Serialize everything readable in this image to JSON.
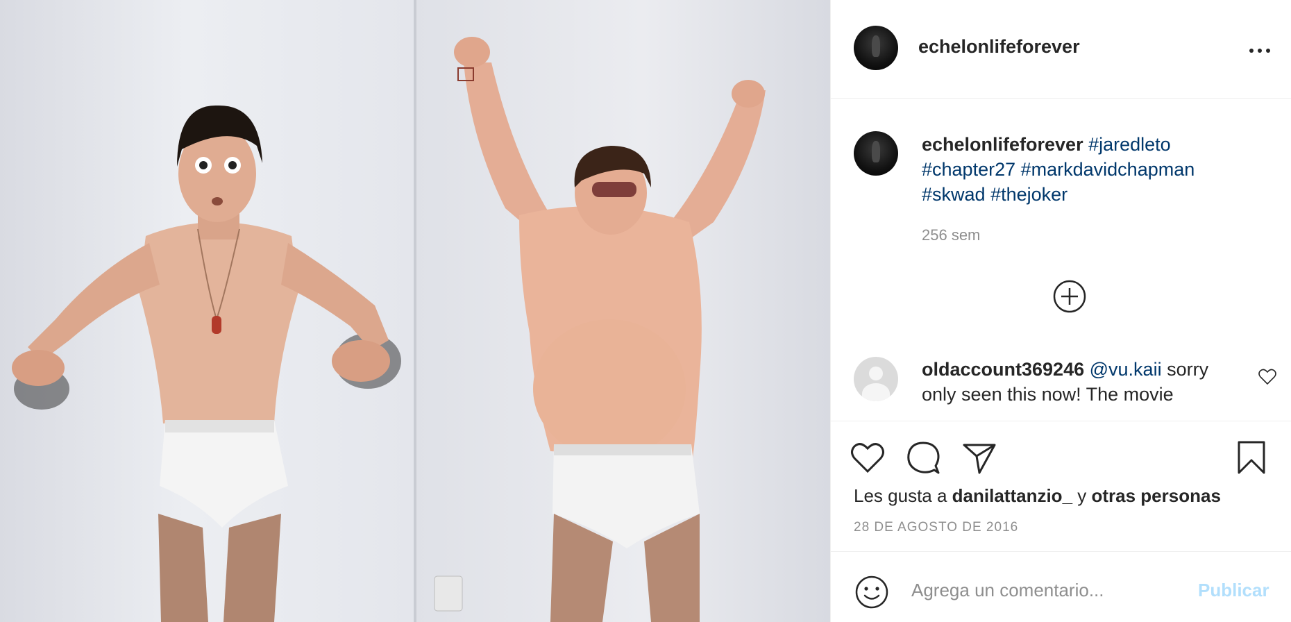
{
  "post": {
    "author": "echelonlifeforever",
    "more_icon": "more-horizontal-icon"
  },
  "caption": {
    "author": "echelonlifeforever",
    "hashtags": [
      "#jaredleto",
      "#chapter27",
      "#markdavidchapman",
      "#skwad",
      "#thejoker"
    ],
    "time_ago": "256 sem",
    "load_more_icon": "plus-circle-icon"
  },
  "comment": {
    "author": "oldaccount369246",
    "mention": "@vu.kaii",
    "text": "sorry only seen this now! The movie",
    "like_icon": "heart-icon"
  },
  "actions": {
    "like_icon": "heart-icon",
    "comment_icon": "comment-icon",
    "share_icon": "paper-plane-icon",
    "save_icon": "bookmark-icon"
  },
  "likes": {
    "prefix": "Les gusta a",
    "user": "danilattanzio_",
    "connector": "y",
    "others": "otras personas"
  },
  "date": "28 DE AGOSTO DE 2016",
  "add_comment": {
    "emoji_icon": "smiley-icon",
    "placeholder": "Agrega un comentario...",
    "publish_label": "Publicar"
  },
  "colors": {
    "hashtag": "#00376b",
    "publish_disabled": "#b2dffc",
    "secondary_text": "#8e8e8e"
  }
}
